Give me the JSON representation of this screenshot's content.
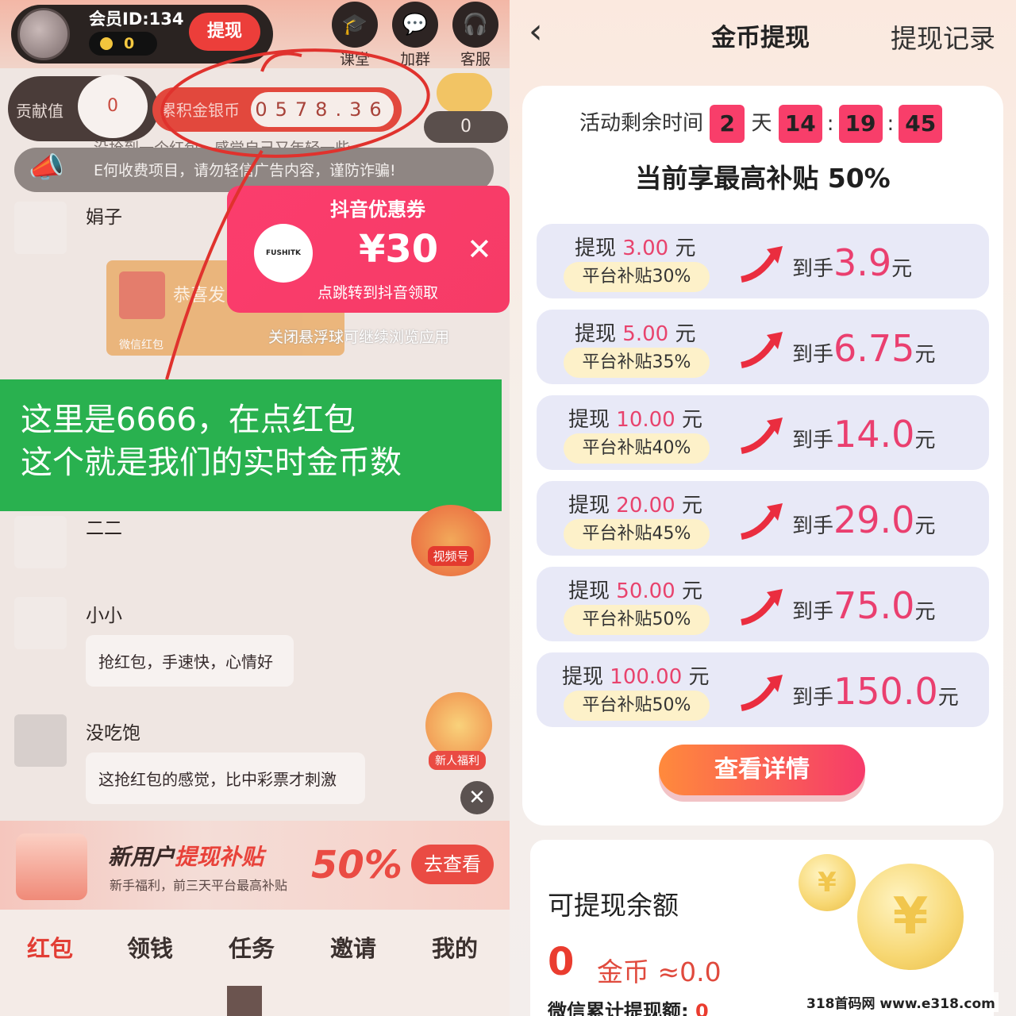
{
  "left": {
    "member_id": "会员ID:134",
    "coin_count": "0",
    "withdraw_btn": "提现",
    "top_icons": [
      {
        "label": "课堂",
        "icon": "graduation-cap-icon"
      },
      {
        "label": "加群",
        "icon": "chat-group-icon"
      },
      {
        "label": "客服",
        "icon": "headset-icon"
      }
    ],
    "contribution_label": "贡献值",
    "contribution_value": "0",
    "accum_label": "累积金银币",
    "accum_value": "0578.36",
    "piggy_value": "0",
    "marquee_ghost": "没抢到一个红包，感觉自己又年轻一些",
    "marquee_text": "E何收费项目，请勿轻信广告内容，谨防诈骗!",
    "chats": [
      {
        "name": "娟子"
      },
      {
        "name": "二二"
      },
      {
        "name": "小小",
        "message": "抢红包，手速快，心情好"
      },
      {
        "name": "没吃饱",
        "message": "这抢红包的感觉，比中彩票才刺激"
      }
    ],
    "redpacket": {
      "title": "恭喜发",
      "footer": "微信红包"
    },
    "coupon": {
      "title": "抖音优惠券",
      "logo": "FUSHITK",
      "amount": "¥30",
      "sub": "点跳转到抖音领取"
    },
    "float_note": "关闭悬浮球可继续浏览应用",
    "green_note_line1": "这里是6666，在点红包",
    "green_note_line2": "这个就是我们的实时金币数",
    "video_badge": "视频号",
    "newbie_badge": "新人福利",
    "banner": {
      "title_a": "新用户",
      "title_b": "提现补贴",
      "sub": "新手福利，前三天平台最高补贴",
      "pct": "50%",
      "btn": "去查看"
    },
    "nav": [
      "红包",
      "领钱",
      "任务",
      "邀请",
      "我的"
    ],
    "accent": "#e23d34"
  },
  "right": {
    "title": "金币提现",
    "records": "提现记录",
    "timer_label": "活动剩余时间",
    "timer_days": "2",
    "timer_day_unit": "天",
    "timer_h": "14",
    "timer_m": "19",
    "timer_s": "45",
    "max_subsidy": "当前享最高补贴 50%",
    "tiers": [
      {
        "amount": "3.00",
        "badge": "平台补贴30%",
        "get": "3.9"
      },
      {
        "amount": "5.00",
        "badge": "平台补贴35%",
        "get": "6.75"
      },
      {
        "amount": "10.00",
        "badge": "平台补贴40%",
        "get": "14.0"
      },
      {
        "amount": "20.00",
        "badge": "平台补贴45%",
        "get": "29.0"
      },
      {
        "amount": "50.00",
        "badge": "平台补贴50%",
        "get": "75.0"
      },
      {
        "amount": "100.00",
        "badge": "平台补贴50%",
        "get": "150.0"
      }
    ],
    "withdraw_word": "提现",
    "yuan": "元",
    "get_word": "到手",
    "detail_btn": "查看详情",
    "balance_title": "可提现余额",
    "balance_value": "0",
    "balance_unit": "金币 ≈0.0",
    "wechat_total_label": "微信累计提现额:",
    "wechat_total_value": "0",
    "accent": "#f83e6a"
  },
  "watermark": "318首码网 www.e318.com"
}
